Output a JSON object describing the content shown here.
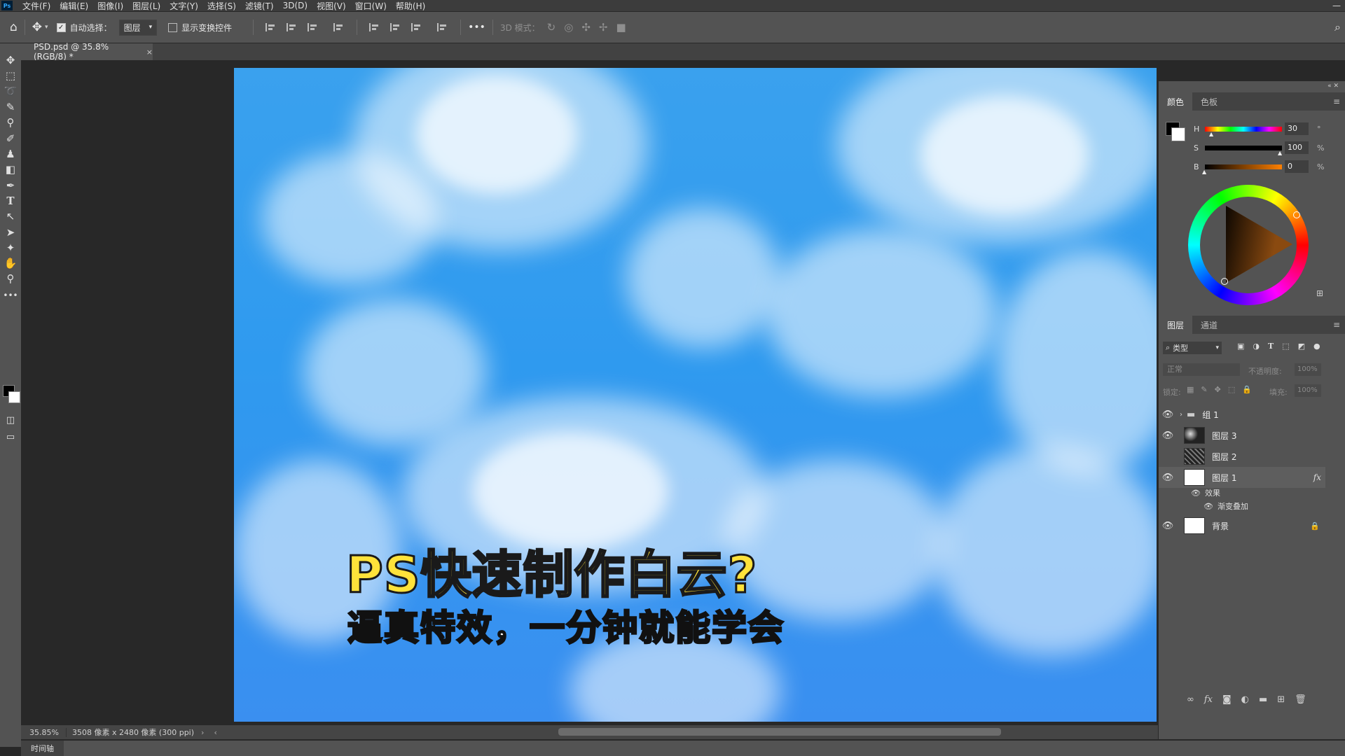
{
  "menubar": {
    "app_logo": "Ps",
    "items": [
      "文件(F)",
      "编辑(E)",
      "图像(I)",
      "图层(L)",
      "文字(Y)",
      "选择(S)",
      "滤镜(T)",
      "3D(D)",
      "视图(V)",
      "窗口(W)",
      "帮助(H)"
    ]
  },
  "options": {
    "auto_select_label": "自动选择：",
    "auto_select_checked": true,
    "target_value": "图层",
    "show_transform_label": "显示变换控件",
    "mode_3d_label": "3D 模式："
  },
  "document": {
    "tab_title": "PSD.psd @ 35.8%(RGB/8) *",
    "close_glyph": "×",
    "title_text": "PS快速制作白云?",
    "subtitle_text": "逼真特效，一分钟就能学会"
  },
  "status": {
    "zoom": "35.85%",
    "doc_info": "3508 像素 x 2480 像素 (300 ppi)"
  },
  "timeline_label": "时间轴",
  "color_panel": {
    "tabs": [
      "颜色",
      "色板"
    ],
    "h_label": "H",
    "h_value": "30",
    "s_label": "S",
    "s_value": "100",
    "s_unit": "%",
    "b_label": "B",
    "b_value": "0",
    "b_unit": "%"
  },
  "layers_panel": {
    "tabs": [
      "图层",
      "通道"
    ],
    "filter_label": "类型",
    "blend_mode": "正常",
    "opacity_label": "不透明度:",
    "opacity_value": "100%",
    "lock_label": "锁定:",
    "fill_label": "填充:",
    "fill_value": "100%",
    "layers": [
      {
        "name": "组 1",
        "visible": true
      },
      {
        "name": "图层 3",
        "visible": true
      },
      {
        "name": "图层 2",
        "visible": false
      },
      {
        "name": "图层 1",
        "visible": true,
        "fx": "fx"
      },
      {
        "name": "效果",
        "visible": true
      },
      {
        "name": "渐变叠加",
        "visible": true
      },
      {
        "name": "背景",
        "visible": true
      }
    ]
  }
}
